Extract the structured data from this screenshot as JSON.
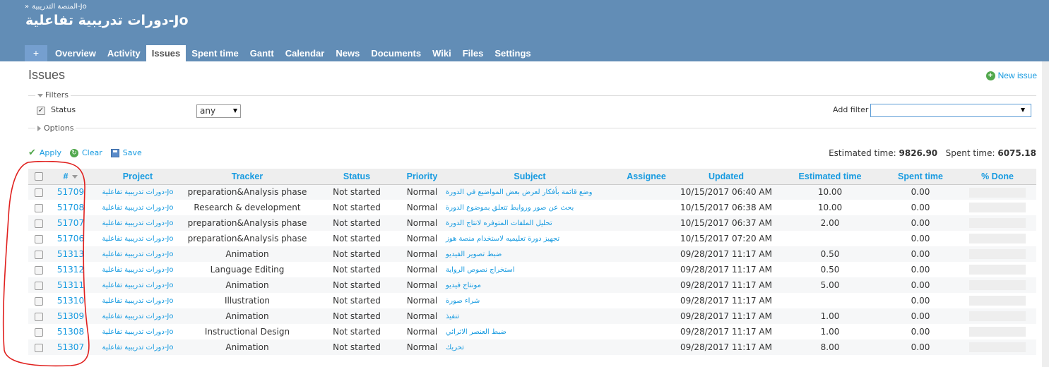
{
  "header": {
    "breadcrumb": "المنصة التدريبية-Jo",
    "breadcrumb_sep": "»",
    "project_title": "دورات تدريبية تفاعلية-Jo",
    "menu": {
      "new": "+",
      "items": [
        "Overview",
        "Activity",
        "Issues",
        "Spent time",
        "Gantt",
        "Calendar",
        "News",
        "Documents",
        "Wiki",
        "Files",
        "Settings"
      ],
      "selected": "Issues"
    }
  },
  "page": {
    "title": "Issues",
    "new_issue": "New issue"
  },
  "filters": {
    "legend": "Filters",
    "status_label": "Status",
    "status_value": "any",
    "add_filter_label": "Add filter",
    "add_filter_value": "",
    "options_legend": "Options"
  },
  "actions": {
    "apply": "Apply",
    "clear": "Clear",
    "save": "Save"
  },
  "totals": {
    "estimated_label": "Estimated time:",
    "estimated_value": "9826.90",
    "spent_label": "Spent time:",
    "spent_value": "6075.18"
  },
  "table": {
    "columns": [
      "#",
      "Project",
      "Tracker",
      "Status",
      "Priority",
      "Subject",
      "Assignee",
      "Updated",
      "Estimated time",
      "Spent time",
      "% Done"
    ],
    "rows": [
      {
        "id": "51709",
        "project": "دورات تدريبية تفاعلية-Jo",
        "tracker": "preparation&Analysis phase",
        "status": "Not started",
        "priority": "Normal",
        "subject": "وضع قائمة بأفكار لعرض بعض المواضيع في الدورة",
        "assignee": "",
        "updated": "10/15/2017 06:40 AM",
        "estimated": "10.00",
        "spent": "0.00",
        "done": 0
      },
      {
        "id": "51708",
        "project": "دورات تدريبية تفاعلية-Jo",
        "tracker": "Research & development",
        "status": "Not started",
        "priority": "Normal",
        "subject": "بحث عن صور وروابط تتعلق بموضوع الدورة",
        "assignee": "",
        "updated": "10/15/2017 06:38 AM",
        "estimated": "10.00",
        "spent": "0.00",
        "done": 0
      },
      {
        "id": "51707",
        "project": "دورات تدريبية تفاعلية-Jo",
        "tracker": "preparation&Analysis phase",
        "status": "Not started",
        "priority": "Normal",
        "subject": "تحليل الملفات المتوفره لانتاج الدورة",
        "assignee": "",
        "updated": "10/15/2017 06:37 AM",
        "estimated": "2.00",
        "spent": "0.00",
        "done": 0
      },
      {
        "id": "51706",
        "project": "دورات تدريبية تفاعلية-Jo",
        "tracker": "preparation&Analysis phase",
        "status": "Not started",
        "priority": "Normal",
        "subject": "تجهيز دورة تعليميه لاستخدام منصة هوز",
        "assignee": "",
        "updated": "10/15/2017 07:20 AM",
        "estimated": "",
        "spent": "0.00",
        "done": 0
      },
      {
        "id": "51313",
        "project": "دورات تدريبية تفاعلية-Jo",
        "tracker": "Animation",
        "status": "Not started",
        "priority": "Normal",
        "subject": "ضبط تصوير الفيديو",
        "assignee": "",
        "updated": "09/28/2017 11:17 AM",
        "estimated": "0.50",
        "spent": "0.00",
        "done": 0
      },
      {
        "id": "51312",
        "project": "دورات تدريبية تفاعلية-Jo",
        "tracker": "Language Editing",
        "status": "Not started",
        "priority": "Normal",
        "subject": "استخراج نصوص الرواية",
        "assignee": "",
        "updated": "09/28/2017 11:17 AM",
        "estimated": "0.50",
        "spent": "0.00",
        "done": 0
      },
      {
        "id": "51311",
        "project": "دورات تدريبية تفاعلية-Jo",
        "tracker": "Animation",
        "status": "Not started",
        "priority": "Normal",
        "subject": "مونتاج فيديو",
        "assignee": "",
        "updated": "09/28/2017 11:17 AM",
        "estimated": "5.00",
        "spent": "0.00",
        "done": 0
      },
      {
        "id": "51310",
        "project": "دورات تدريبية تفاعلية-Jo",
        "tracker": "Illustration",
        "status": "Not started",
        "priority": "Normal",
        "subject": "شراء صورة",
        "assignee": "",
        "updated": "09/28/2017 11:17 AM",
        "estimated": "",
        "spent": "0.00",
        "done": 0
      },
      {
        "id": "51309",
        "project": "دورات تدريبية تفاعلية-Jo",
        "tracker": "Animation",
        "status": "Not started",
        "priority": "Normal",
        "subject": "تنفيذ",
        "assignee": "",
        "updated": "09/28/2017 11:17 AM",
        "estimated": "1.00",
        "spent": "0.00",
        "done": 0
      },
      {
        "id": "51308",
        "project": "دورات تدريبية تفاعلية-Jo",
        "tracker": "Instructional Design",
        "status": "Not started",
        "priority": "Normal",
        "subject": "ضبط العنصر الاثرائي",
        "assignee": "",
        "updated": "09/28/2017 11:17 AM",
        "estimated": "1.00",
        "spent": "0.00",
        "done": 0
      },
      {
        "id": "51307",
        "project": "دورات تدريبية تفاعلية-Jo",
        "tracker": "Animation",
        "status": "Not started",
        "priority": "Normal",
        "subject": "تحريك",
        "assignee": "",
        "updated": "09/28/2017 11:17 AM",
        "estimated": "8.00",
        "spent": "0.00",
        "done": 0
      }
    ]
  },
  "colors": {
    "header_bg": "#628db6",
    "link": "#169ae0",
    "annotation": "#e0201e"
  }
}
